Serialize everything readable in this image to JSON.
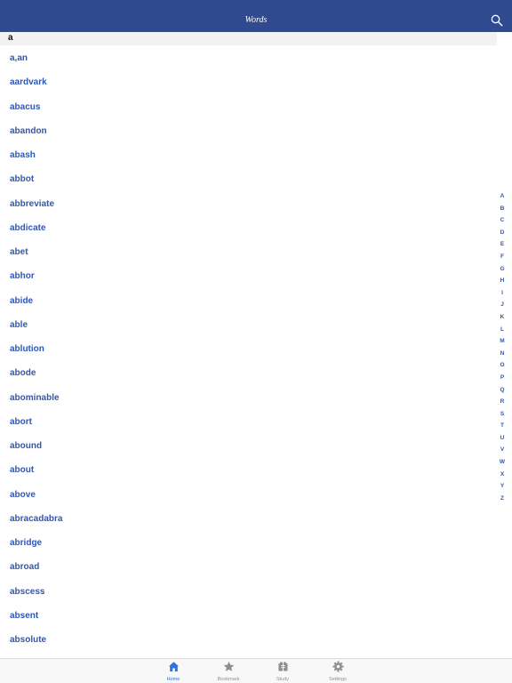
{
  "header": {
    "title": "Words",
    "search_icon": "search-icon"
  },
  "section": {
    "letter": "a"
  },
  "words": [
    "a,an",
    "aardvark",
    "abacus",
    "abandon",
    "abash",
    "abbot",
    "abbreviate",
    "abdicate",
    "abet",
    "abhor",
    "abide",
    "able",
    "ablution",
    "abode",
    "abominable",
    "abort",
    "abound",
    "about",
    "above",
    "abracadabra",
    "abridge",
    "abroad",
    "abscess",
    "absent",
    "absolute"
  ],
  "index_letters": [
    "A",
    "B",
    "C",
    "D",
    "E",
    "F",
    "G",
    "H",
    "I",
    "J",
    "K",
    "L",
    "M",
    "N",
    "O",
    "P",
    "Q",
    "R",
    "S",
    "T",
    "U",
    "V",
    "W",
    "X",
    "Y",
    "Z"
  ],
  "tabs": [
    {
      "label": "Home",
      "icon": "home-icon",
      "active": true
    },
    {
      "label": "Bookmark",
      "icon": "star-icon",
      "active": false
    },
    {
      "label": "Study",
      "icon": "study-icon",
      "active": false
    },
    {
      "label": "Settings",
      "icon": "gear-icon",
      "active": false
    }
  ],
  "colors": {
    "nav_bar": "#2f4a8f",
    "word_text": "#2f57b5",
    "active_tab": "#2f6fde",
    "inactive_tab": "#8e8e8e"
  }
}
